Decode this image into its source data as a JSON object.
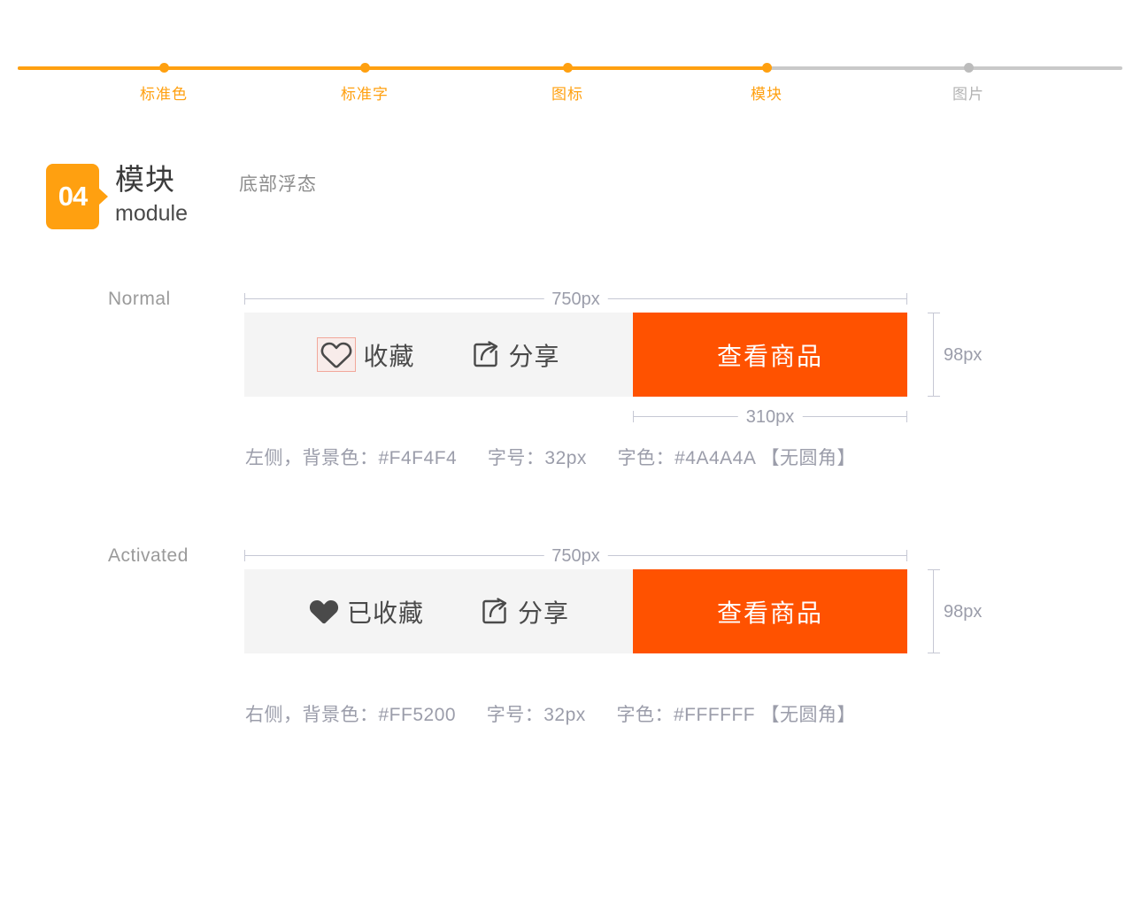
{
  "stepper": {
    "progress_percent": 66,
    "active_color": "#FFA010",
    "inactive_color": "#b3b3b3",
    "steps": [
      {
        "label": "标准色",
        "state": "done"
      },
      {
        "label": "标准字",
        "state": "done"
      },
      {
        "label": "图标",
        "state": "done"
      },
      {
        "label": "模块",
        "state": "current"
      },
      {
        "label": "图片",
        "state": "todo"
      }
    ]
  },
  "section": {
    "number": "04",
    "title_cn": "模块",
    "title_en": "module",
    "subtitle": "底部浮态",
    "badge_color": "#FFA010"
  },
  "states": [
    {
      "name": "Normal",
      "width_dim": "750px",
      "height_dim": "98px",
      "cta_dim": "310px",
      "bar_bg": "#F4F4F4",
      "favorite_icon": "heart-outline-icon",
      "favorite_label": "收藏",
      "favorite_selected_box": true,
      "share_icon": "share-box-arrow-icon",
      "share_label": "分享",
      "cta_label": "查看商品",
      "cta_color": "#FF5200",
      "caption": "左侧，背景色：#F4F4F4",
      "caption_size": "字号：32px",
      "caption_color": "字色：#4A4A4A 【无圆角】"
    },
    {
      "name": "Activated",
      "width_dim": "750px",
      "height_dim": "98px",
      "cta_dim": "",
      "bar_bg": "#F4F4F4",
      "favorite_icon": "heart-filled-icon",
      "favorite_label": "已收藏",
      "favorite_selected_box": false,
      "share_icon": "share-box-arrow-icon",
      "share_label": "分享",
      "cta_label": "查看商品",
      "cta_color": "#FF5200",
      "caption": "右侧，背景色：#FF5200",
      "caption_size": "字号：32px",
      "caption_color": "字色：#FFFFFF 【无圆角】"
    }
  ]
}
